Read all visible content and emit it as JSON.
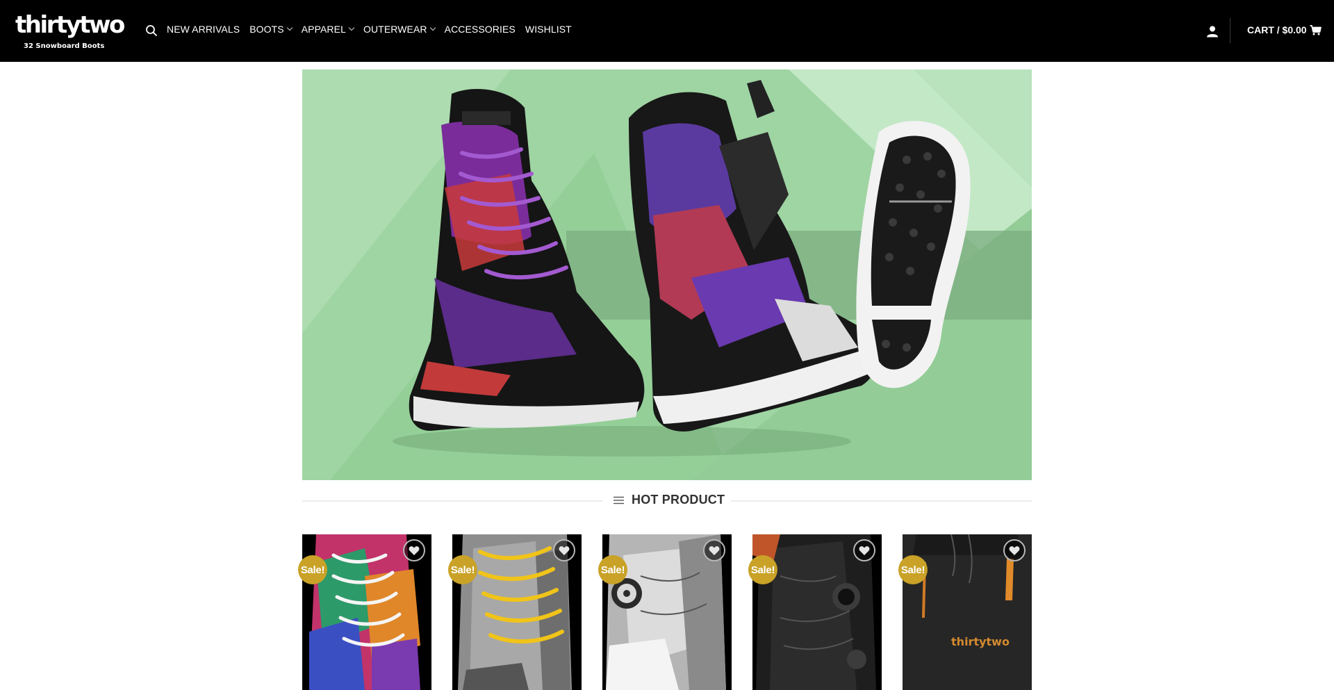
{
  "brand": {
    "wordmark": "thirtytwo",
    "tagline": "32 Snowboard Boots"
  },
  "nav": {
    "items": [
      {
        "label": "NEW ARRIVALS",
        "dropdown": false
      },
      {
        "label": "BOOTS",
        "dropdown": true
      },
      {
        "label": "APPAREL",
        "dropdown": true
      },
      {
        "label": "OUTERWEAR",
        "dropdown": true
      },
      {
        "label": "ACCESSORIES",
        "dropdown": false
      },
      {
        "label": "WISHLIST",
        "dropdown": false
      }
    ]
  },
  "cart": {
    "label": "CART / $0.00"
  },
  "icons": {
    "search": "search-icon",
    "account": "user-icon",
    "cart": "shopping-cart-icon",
    "menu": "menu-lines-icon",
    "wishlist": "heart-icon"
  },
  "section": {
    "title": "HOT PRODUCT"
  },
  "products": [
    {
      "badge": "Sale!",
      "image": "tie-dye lace snowboard boot"
    },
    {
      "badge": "Sale!",
      "image": "grey and yellow lace snowboard boot"
    },
    {
      "badge": "Sale!",
      "image": "white and grey BOA snowboard boot"
    },
    {
      "badge": "Sale!",
      "image": "black BOA snowboard boot"
    },
    {
      "badge": "Sale!",
      "image": "black snow pants with orange zippers"
    }
  ],
  "colors": {
    "header_bg": "#000000",
    "hero_bg": "#9fd4a3",
    "sale_badge": "#c9a227",
    "text_dark": "#333333"
  }
}
